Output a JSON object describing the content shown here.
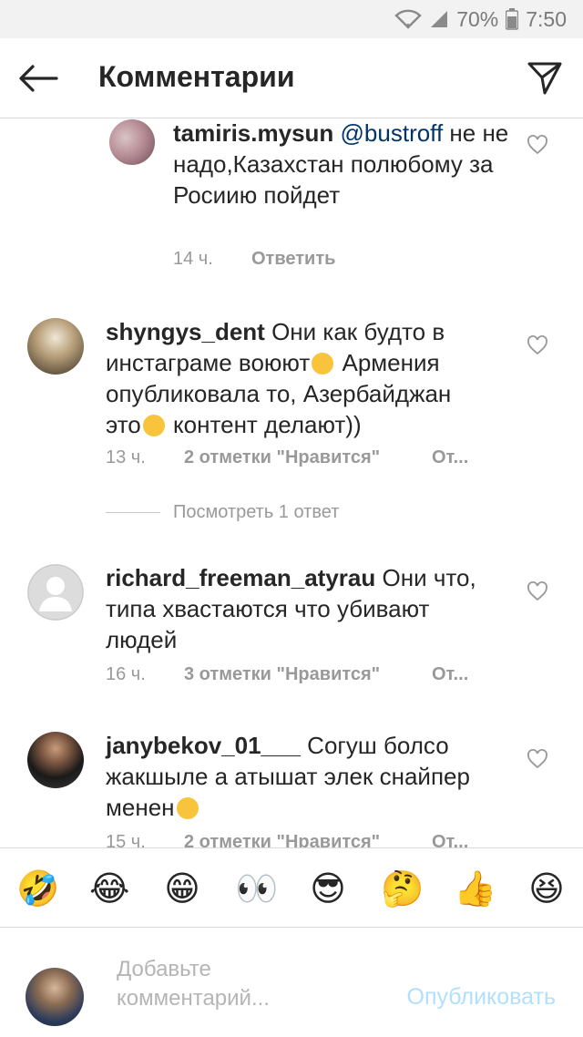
{
  "status_bar": {
    "battery": "70%",
    "time": "7:50"
  },
  "header": {
    "title": "Комментарии"
  },
  "comments": [
    {
      "user": "tamiris.mysun",
      "mention": "@bustroff",
      "text": "не не надо,Казахстан полюбому за Росиию пойдет",
      "time": "14 ч.",
      "reply": "Ответить"
    },
    {
      "user": "shyngys_dent",
      "text_a": "Они как будто в инстаграме воюют",
      "text_b": " Армения опубликовала то, Азербайджан это",
      "text_c": " контент делают))",
      "time": "13 ч.",
      "likes": "2 отметки \"Нравится\"",
      "reply": "От..."
    },
    {
      "user": "richard_freeman_atyrau",
      "text": "Они что, типа хвастаются что убивают людей",
      "time": "16 ч.",
      "likes": "3 отметки \"Нравится\"",
      "reply": "От..."
    },
    {
      "user": "janybekov_01___",
      "text": "Согуш болсо жакшыле а атышат элек снайпер менен",
      "time": "15 ч.",
      "likes": "2 отметки \"Нравится\"",
      "reply": "От..."
    }
  ],
  "view_replies": "Посмотреть 1 ответ",
  "emojis": [
    "🤣",
    "😂",
    "😁",
    "👀",
    "😎",
    "🤔",
    "👍",
    "😆"
  ],
  "composer": {
    "placeholder": "Добавьте комментарий...",
    "publish_label": "Опубликовать"
  },
  "colors": {
    "accent": "#3897f0",
    "publish_disabled": "#b2dffc",
    "meta": "#999999"
  }
}
